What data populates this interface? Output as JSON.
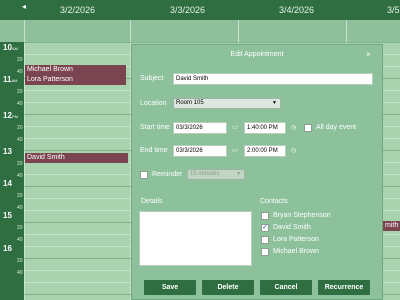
{
  "calendar": {
    "nav_prev": "◂",
    "days": [
      "3/2/2026",
      "3/3/2026",
      "3/4/2026",
      "3/5"
    ],
    "hours": [
      {
        "hour": "10",
        "ampm": "AM"
      },
      {
        "hour": "11",
        "ampm": "AM"
      },
      {
        "hour": "12",
        "ampm": "PM"
      },
      {
        "hour": "13",
        "ampm": ""
      },
      {
        "hour": "14",
        "ampm": ""
      },
      {
        "hour": "15",
        "ampm": ""
      },
      {
        "hour": "16",
        "ampm": ""
      }
    ],
    "minutes": [
      "20",
      "40"
    ],
    "appointments": [
      {
        "label": "Michael Brown"
      },
      {
        "label": "Lora Patterson"
      },
      {
        "label": "David Smith"
      },
      {
        "label": "mith"
      }
    ]
  },
  "dialog": {
    "title": "Edit Appointment",
    "close_glyph": "×",
    "subject_label": "Subject",
    "subject_value": "David Smith",
    "location_label": "Location",
    "location_value": "Room 105",
    "start_label": "Start time",
    "start_date": "03/3/2026",
    "start_time": "1:40:00 PM",
    "all_day_label": "All day event",
    "all_day_checked": false,
    "end_label": "End time",
    "end_date": "03/3/2026",
    "end_time": "2:00:00 PM",
    "reminder_label": "Reminder",
    "reminder_checked": false,
    "reminder_value": "15 minutes",
    "details_label": "Details",
    "details_value": "",
    "contacts_label": "Contacts",
    "contacts": [
      {
        "name": "Bryan Stephenson",
        "checked": false
      },
      {
        "name": "David Smith",
        "checked": true
      },
      {
        "name": "Lora Patterson",
        "checked": false
      },
      {
        "name": "Michael Brown",
        "checked": false
      }
    ],
    "buttons": {
      "save": "Save",
      "delete": "Delete",
      "cancel": "Cancel",
      "recurrence": "Recurrence"
    }
  },
  "colors": {
    "header": "#2e6e41",
    "grid": "#a8d3ae",
    "dialog": "#8cc19c",
    "appointment": "#7a4450",
    "button": "#2e6e41"
  },
  "icons": {
    "calendar": "calendar-icon",
    "clock": "clock-icon",
    "close": "close-icon",
    "chevron": "chevron-down-icon"
  }
}
